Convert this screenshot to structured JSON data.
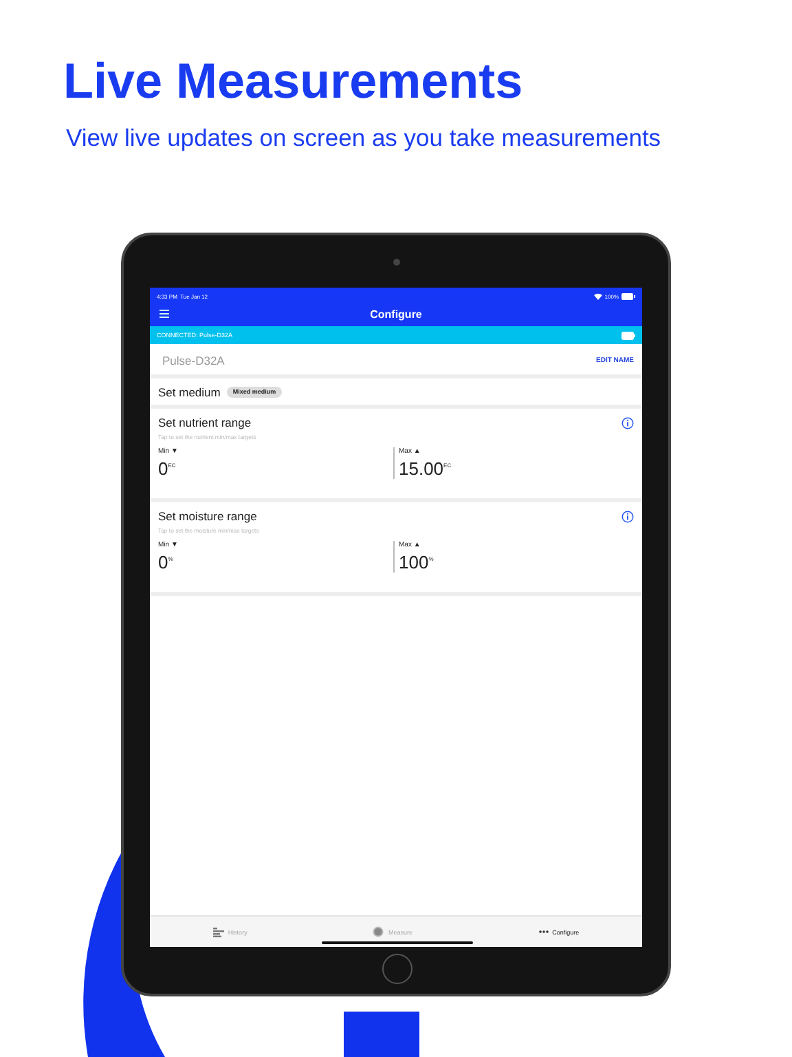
{
  "headline": "Live Measurements",
  "subtitle": "View live updates on screen as you take measurements",
  "status_bar": {
    "time": "4:33 PM",
    "date": "Tue Jan 12",
    "battery": "100%"
  },
  "nav": {
    "title": "Configure"
  },
  "connection": {
    "text": "CONNECTED: Pulse-D32A"
  },
  "device": {
    "name": "Pulse-D32A",
    "action": "EDIT NAME"
  },
  "medium": {
    "label": "Set medium",
    "value": "Mixed medium"
  },
  "ranges": [
    {
      "title": "Set nutrient range",
      "hint": "Tap to set the nutrient min/max targets",
      "min_label": "Min ▼",
      "min_value": "0",
      "min_unit": "EC",
      "max_label": "Max ▲",
      "max_value": "15.00",
      "max_unit": "EC"
    },
    {
      "title": "Set moisture range",
      "hint": "Tap to set the moisture min/max targets",
      "min_label": "Min ▼",
      "min_value": "0",
      "min_unit": "%",
      "max_label": "Max ▲",
      "max_value": "100",
      "max_unit": "%"
    }
  ],
  "tabs": [
    {
      "label": "History",
      "kind": "history",
      "selected": false
    },
    {
      "label": "Measure",
      "kind": "measure",
      "selected": false
    },
    {
      "label": "Configure",
      "kind": "configure",
      "selected": true
    }
  ]
}
